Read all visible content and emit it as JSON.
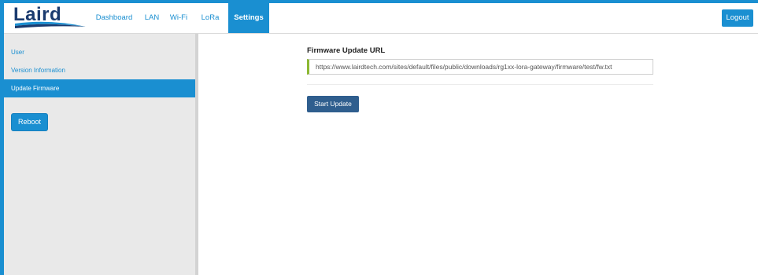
{
  "brand": {
    "logo_text": "Laird"
  },
  "nav": {
    "items": [
      {
        "label": "Dashboard"
      },
      {
        "label": "LAN"
      },
      {
        "label": "Wi-Fi"
      },
      {
        "label": "LoRa"
      },
      {
        "label": "Settings",
        "active": true
      }
    ],
    "logout_label": "Logout"
  },
  "sidebar": {
    "items": [
      {
        "label": "User"
      },
      {
        "label": "Version Information"
      },
      {
        "label": "Update Firmware",
        "active": true
      }
    ],
    "reboot_label": "Reboot"
  },
  "main": {
    "firmware_label": "Firmware Update URL",
    "firmware_url": "https://www.lairdtech.com/sites/default/files/public/downloads/rg1xx-lora-gateway/firmware/test/fw.txt",
    "start_label": "Start Update"
  },
  "colors": {
    "accent": "#1a8fd1",
    "brand_dark": "#1b3b6f",
    "start_button": "#2f5e8e",
    "input_accent": "#8cb832",
    "sidebar_bg": "#e9e9e9"
  }
}
